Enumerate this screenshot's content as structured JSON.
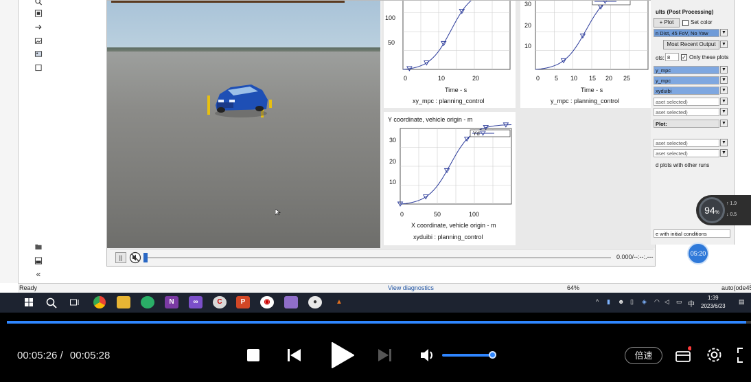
{
  "status_bar": {
    "ready": "Ready",
    "view_diagnostics": "View diagnostics",
    "zoom": "64%",
    "mode": "auto(ode45"
  },
  "playbar": {
    "pause_glyph": "||",
    "time": "0.000/--:--:.---"
  },
  "plots": {
    "xy_mpc": {
      "xlabel": "Time - s",
      "caption": "xy_mpc : planning_control",
      "yticks": [
        "100",
        "50"
      ],
      "xticks": [
        "0",
        "10",
        "20"
      ]
    },
    "y_mpc": {
      "xlabel": "Time - s",
      "caption": "y_mpc : planning_control",
      "yticks": [
        "30",
        "20",
        "10"
      ],
      "xticks": [
        "0",
        "5",
        "10",
        "15",
        "20",
        "25"
      ]
    },
    "xyduibi": {
      "title": "Y coordinate, vehicle origin - m",
      "xlabel": "X coordinate, vehicle origin - m",
      "caption": "xyduibi : planning_control",
      "legend": "Yd",
      "yticks": [
        "30",
        "20",
        "10"
      ],
      "xticks": [
        "0",
        "50",
        "100"
      ]
    }
  },
  "right_panel": {
    "title": "ults (Post Processing)",
    "plot_button": "+ Plot",
    "set_color": "Set color",
    "dataset": "n Dist, 45 FoV, No Yaw",
    "most_recent": "Most Recent Output",
    "plots_label": "ots:",
    "plots_count": "8",
    "only_these": "Only these plots",
    "plot_fields": [
      "y_mpc",
      "y_mpc",
      "xyduibi"
    ],
    "empty_fields": [
      "aset selected)",
      "aset selected)"
    ],
    "plot_label": "Plot:",
    "empty_fields_2": [
      "aset selected)",
      "aset selected)"
    ],
    "other_runs": "d plots with other runs",
    "initial_conditions": "e with initial conditions"
  },
  "overlay": {
    "speed_percent": "94",
    "percent_sign": "%",
    "up_rate": "1.9",
    "down_rate": "0.5",
    "clock": "05:20"
  },
  "taskbar": {
    "time": "1:39",
    "date": "2023/6/23",
    "ime": "中"
  },
  "player": {
    "current": "00:05:26",
    "separator": "/",
    "total": "00:05:28",
    "progress": 0.994,
    "volume": 0.9,
    "speed_label": "倍速"
  },
  "colors": {
    "accent": "#2f86ff",
    "plot_line": "#2a3a9a"
  }
}
